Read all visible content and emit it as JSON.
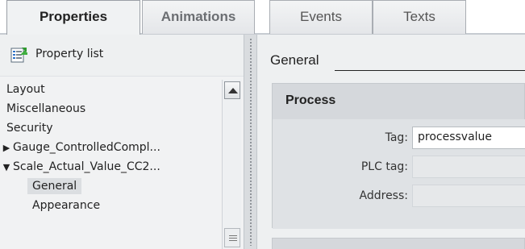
{
  "tabs": [
    {
      "label": "Properties",
      "active": true
    },
    {
      "label": "Animations",
      "active": false
    },
    {
      "label": "Events",
      "active": false
    },
    {
      "label": "Texts",
      "active": false
    }
  ],
  "left_panel": {
    "header_label": "Property list",
    "header_icon": "property-list-icon",
    "tree": [
      {
        "label": "Layout",
        "expander": ""
      },
      {
        "label": "Miscellaneous",
        "expander": ""
      },
      {
        "label": "Security",
        "expander": ""
      },
      {
        "label": "Gauge_ControlledCompl...",
        "expander": "▶"
      },
      {
        "label": "Scale_Actual_Value_CC2...",
        "expander": "▼"
      },
      {
        "label": "General",
        "expander": "",
        "selected": true
      },
      {
        "label": "Appearance",
        "expander": ""
      }
    ]
  },
  "right_panel": {
    "section_title": "General",
    "group_title": "Process",
    "fields": [
      {
        "label": "Tag:",
        "value": "processvalue"
      },
      {
        "label": "PLC tag:",
        "value": ""
      },
      {
        "label": "Address:",
        "value": ""
      }
    ]
  }
}
